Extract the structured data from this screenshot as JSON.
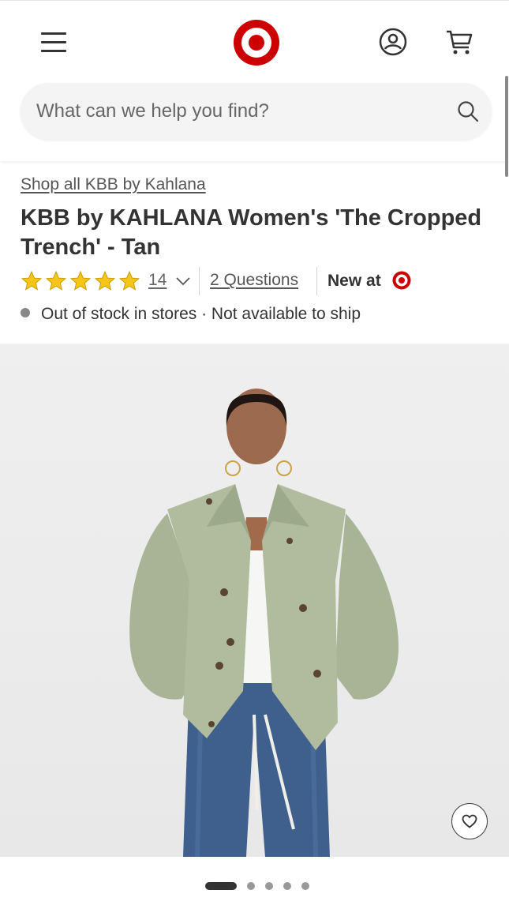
{
  "header": {
    "menu_icon": "hamburger-menu-icon",
    "logo_icon": "target-bullseye-logo",
    "account_icon": "account-user-icon",
    "cart_icon": "shopping-cart-icon"
  },
  "search": {
    "placeholder": "What can we help you find?",
    "value": "",
    "icon": "search-icon"
  },
  "product": {
    "shop_all_link": "Shop all KBB by Kahlana",
    "title": "KBB by KAHLANA Women's 'The Cropped Trench' - Tan",
    "rating": 5,
    "review_count": "14",
    "questions_link": "2 Questions",
    "new_at_label": "New at",
    "stock_status": "Out of stock in stores · Not available to ship"
  },
  "gallery": {
    "image_alt": "Model wearing sage green cropped trench jacket with white top and blue jeans",
    "favorite_icon": "heart-icon",
    "slide_count": 5,
    "active_slide": 1
  },
  "colors": {
    "brand_red": "#cc0000",
    "star_gold": "#f5c518",
    "text_primary": "#333333",
    "search_bg": "#f4f4f4"
  }
}
